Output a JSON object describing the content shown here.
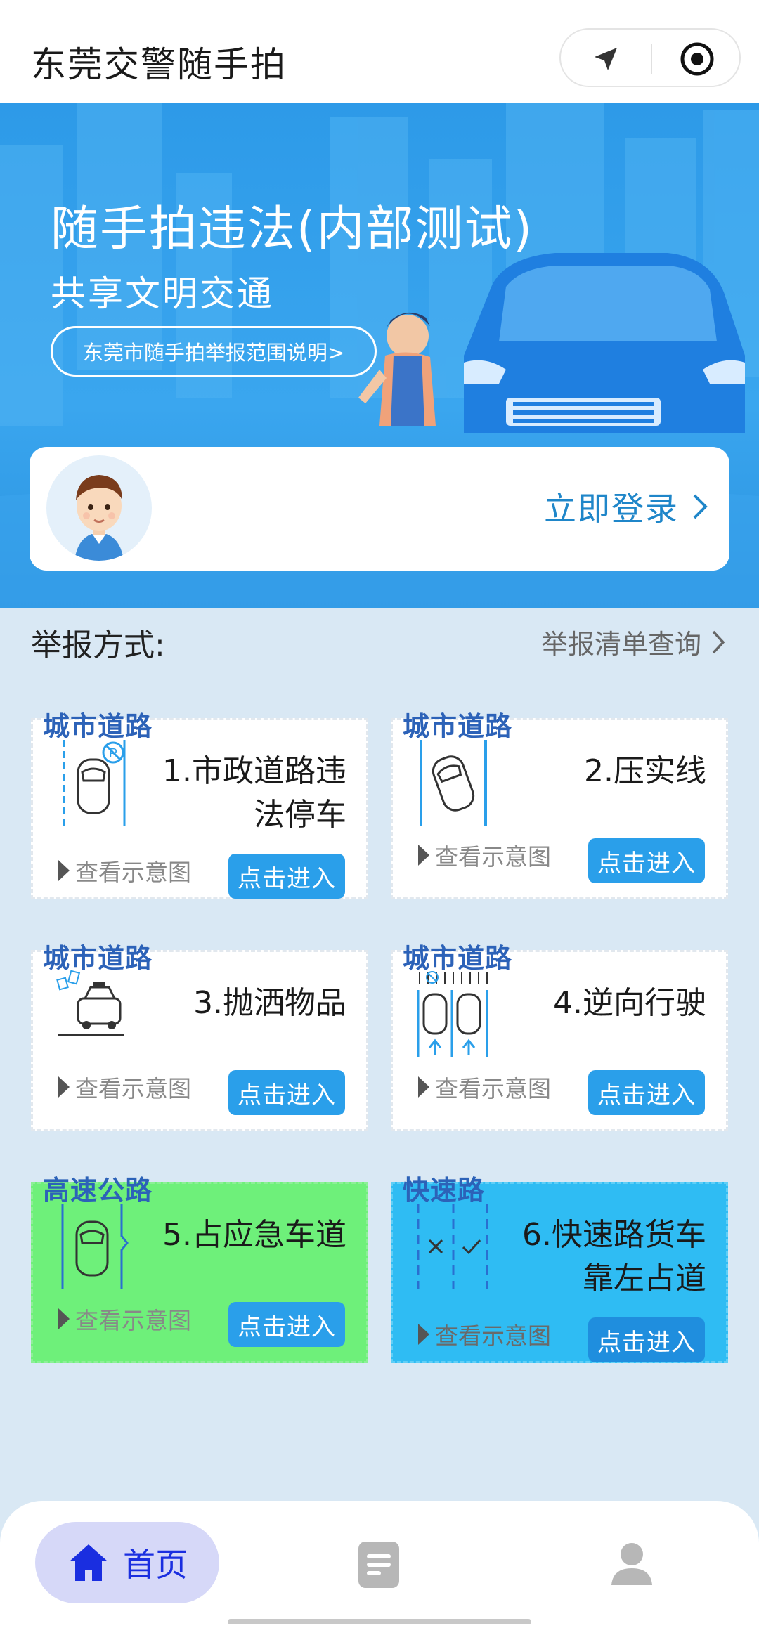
{
  "app": {
    "title": "东莞交警随手拍"
  },
  "banner": {
    "title": "随手拍违法(内部测试)",
    "subtitle": "共享文明交通",
    "scope_link": "东莞市随手拍举报范围说明>"
  },
  "login": {
    "label": "立即登录"
  },
  "section": {
    "title": "举报方式:",
    "query_link": "举报清单查询"
  },
  "cards": [
    {
      "tag": "城市道路",
      "title": "1.市政道路违法停车",
      "view": "查看示意图",
      "enter": "点击进入"
    },
    {
      "tag": "城市道路",
      "title": "2.压实线",
      "view": "查看示意图",
      "enter": "点击进入"
    },
    {
      "tag": "城市道路",
      "title": "3.抛洒物品",
      "view": "查看示意图",
      "enter": "点击进入"
    },
    {
      "tag": "城市道路",
      "title": "4.逆向行驶",
      "view": "查看示意图",
      "enter": "点击进入"
    },
    {
      "tag": "高速公路",
      "title": "5.占应急车道",
      "view": "查看示意图",
      "enter": "点击进入"
    },
    {
      "tag": "快速路",
      "title": "6.快速路货车靠左占道",
      "view": "查看示意图",
      "enter": "点击进入"
    }
  ],
  "nav": {
    "home": "首页"
  },
  "colors": {
    "accent": "#2a9fea",
    "banner": "#2d9ae8",
    "nav_active": "#1a2ee0",
    "tag": "#2c62b8"
  },
  "icons": [
    "location-arrow-icon",
    "target-circle-icon",
    "chevron-right-icon",
    "car-parking-icon",
    "car-solid-line-icon",
    "car-littering-icon",
    "car-wrong-way-icon",
    "emergency-lane-icon",
    "expressway-lane-icon",
    "home-icon",
    "document-icon",
    "user-icon"
  ]
}
